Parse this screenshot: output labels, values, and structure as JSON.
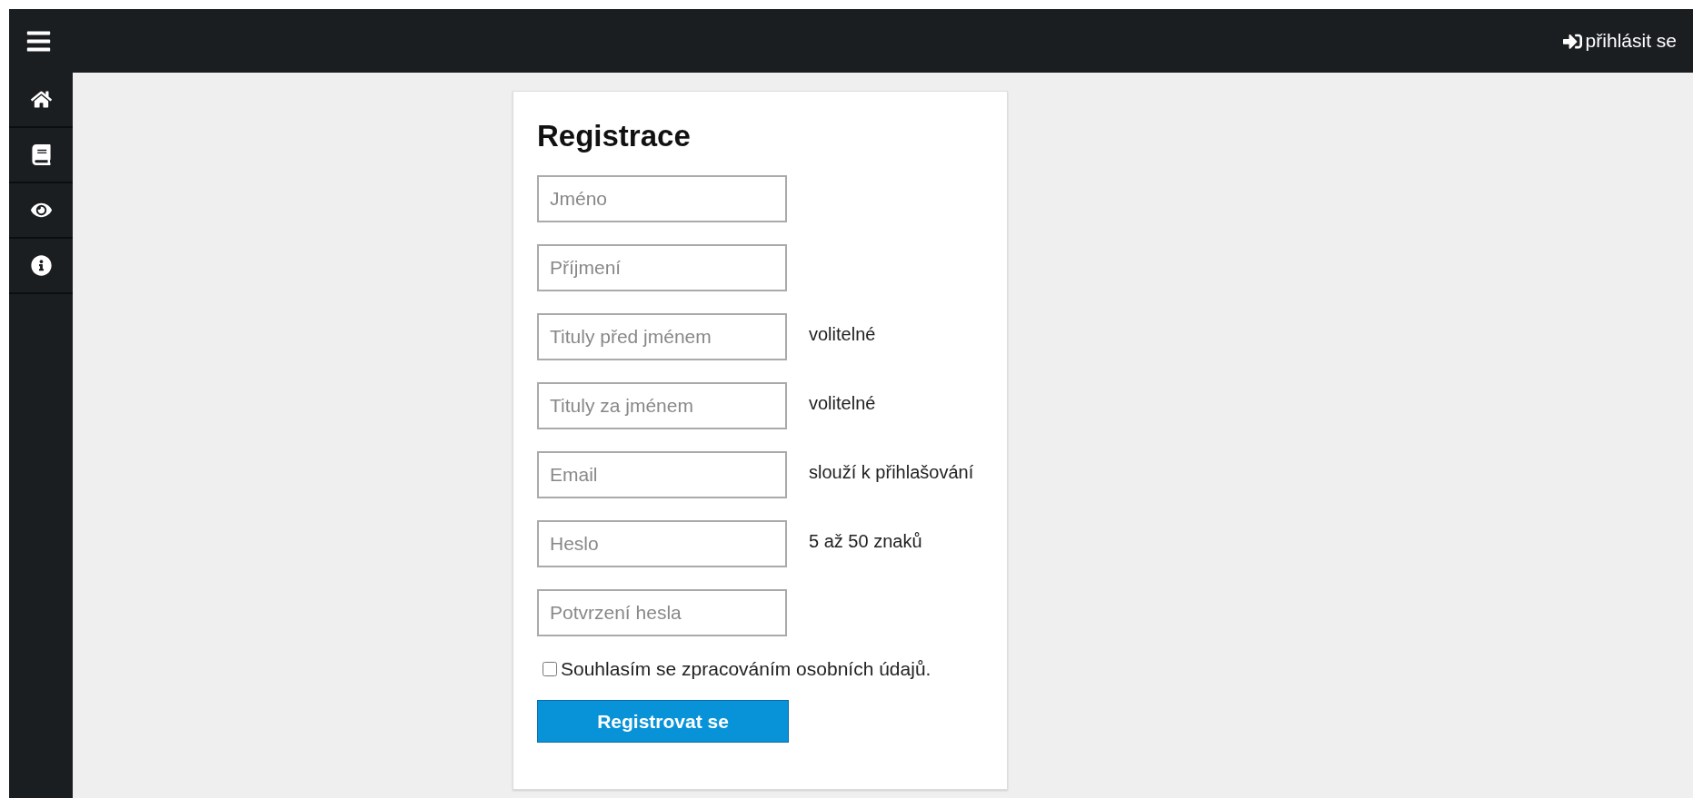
{
  "topbar": {
    "login_link": "přihlásit se"
  },
  "sidebar": {
    "items": [
      {
        "kind": "home"
      },
      {
        "kind": "book"
      },
      {
        "kind": "eye"
      },
      {
        "kind": "info"
      }
    ]
  },
  "form": {
    "title": "Registrace",
    "fields": [
      {
        "placeholder": "Jméno"
      },
      {
        "placeholder": "Příjmení"
      },
      {
        "placeholder": "Tituly před jménem",
        "note": "volitelné"
      },
      {
        "placeholder": "Tituly za jménem",
        "note": "volitelné"
      },
      {
        "placeholder": "Email",
        "note": "slouží k přihlašování"
      },
      {
        "placeholder": "Heslo",
        "note": "5 až 50 znaků"
      },
      {
        "placeholder": "Potvrzení hesla"
      }
    ],
    "consent": {
      "label": "Souhlasím se zpracováním osobních údajů.",
      "checked": false
    },
    "submit": "Registrovat se"
  }
}
